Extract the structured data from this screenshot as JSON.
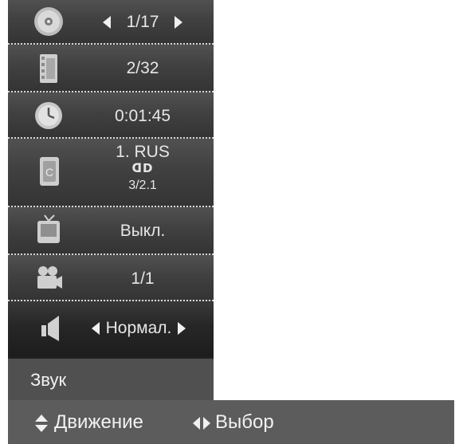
{
  "menu": {
    "rows": [
      {
        "icon": "disc-icon",
        "value": "1/17",
        "has_arrows": true
      },
      {
        "icon": "film-icon",
        "value": "2/32"
      },
      {
        "icon": "clock-icon",
        "value": "0:01:45"
      },
      {
        "icon": "audio-language-icon",
        "value": "1. RUS",
        "badge": "ᗡD",
        "sub": "3/2.1"
      },
      {
        "icon": "tv-subtitle-icon",
        "value": "Выкл."
      },
      {
        "icon": "camera-angle-icon",
        "value": "1/1"
      },
      {
        "icon": "speaker-icon",
        "value": "Нормал.",
        "has_arrows": true,
        "selected": true
      }
    ],
    "selected_label": "Звук"
  },
  "footer": {
    "move_label": "Движение",
    "select_label": "Выбор"
  },
  "colors": {
    "panel": "#3d3d3d",
    "label_bar": "#505050",
    "footer": "#5c5c5c",
    "text": "#e6e6e6"
  }
}
